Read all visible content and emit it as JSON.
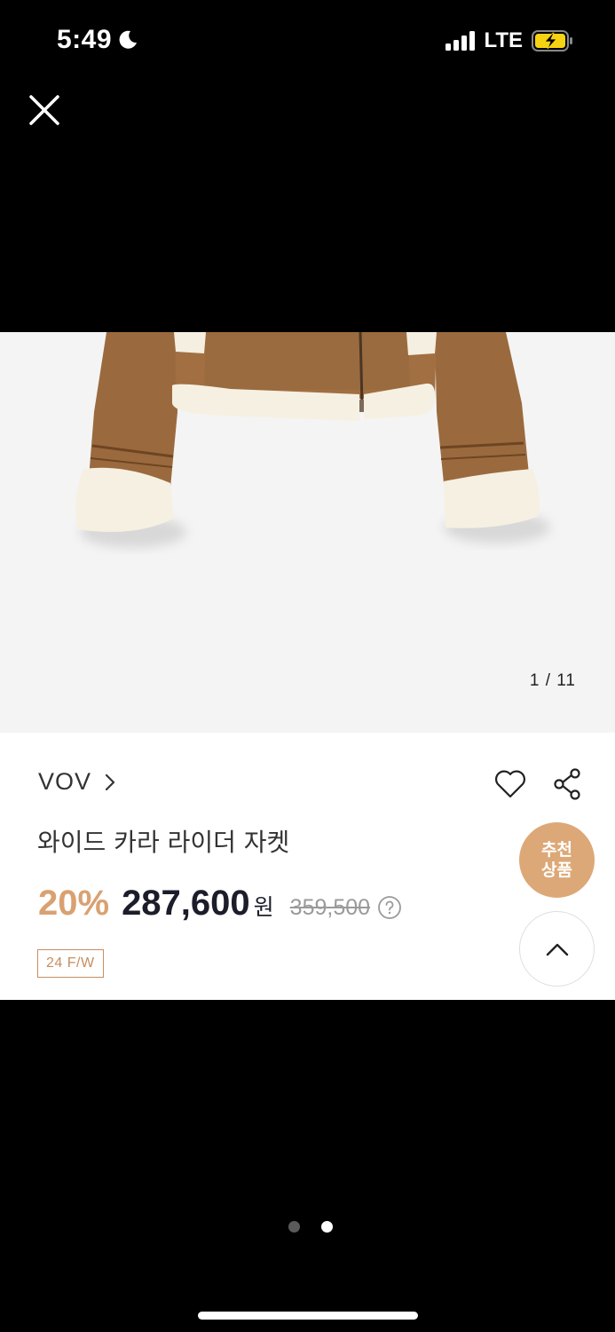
{
  "status_bar": {
    "time": "5:49",
    "network": "LTE",
    "icons": [
      "moon-icon",
      "signal-icon",
      "battery-charging-icon"
    ]
  },
  "viewer": {
    "close_icon": "close-icon",
    "image_counter": "1 / 11",
    "pager": {
      "total": 2,
      "active_index": 1
    }
  },
  "product": {
    "brand": "VOV",
    "name": "와이드 카라 라이더 자켓",
    "discount": "20%",
    "price": "287,600",
    "currency": "원",
    "original_price": "359,500",
    "season_tag": "24 F/W"
  },
  "floating": {
    "recommend_line1": "추천",
    "recommend_line2": "상품"
  },
  "colors": {
    "accent": "#d9a172",
    "recommend_bg": "#dda877",
    "price_text": "#1b1d2a",
    "tag_border": "#c88d5e"
  }
}
